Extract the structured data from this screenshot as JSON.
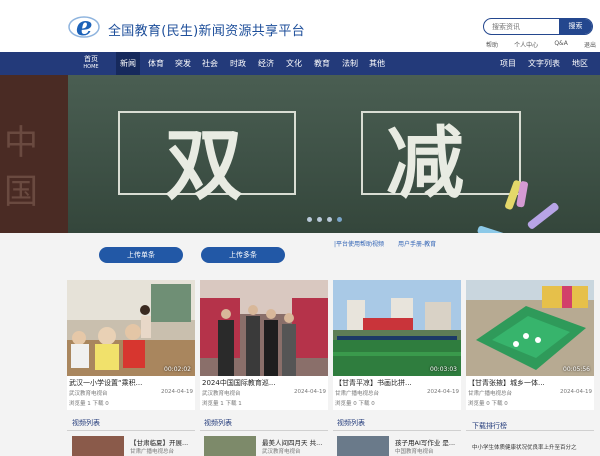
{
  "header": {
    "site_title": "全国教育(民生)新闻资源共享平台",
    "search_placeholder": "搜索资讯",
    "search_button": "搜索",
    "links": [
      "帮助",
      "个人中心",
      "Q&A",
      "退出"
    ]
  },
  "nav": {
    "home_cn": "首页",
    "home_en": "HOME",
    "items": [
      "新闻",
      "体育",
      "突发",
      "社会",
      "时政",
      "经济",
      "文化",
      "教育",
      "法制",
      "其他"
    ],
    "right_items": [
      "项目",
      "文字列表",
      "地区"
    ],
    "active_index": 0
  },
  "banner": {
    "left_text": "中国",
    "char_left": "双",
    "char_right": "减",
    "slide_count": 4,
    "active_slide": 3
  },
  "upload": {
    "single_label": "上传单条",
    "multi_label": "上传多条",
    "help_link_1": "|平台使用帮助视频",
    "help_link_2": "用户手册-教育"
  },
  "cards": [
    {
      "title": "武汉一小学设置“乘积...",
      "time": "00:02:02",
      "source": "武汉教育电视台",
      "date": "2024-04-19",
      "views": "浏览量 1",
      "downloads": "下载 0"
    },
    {
      "title": "2024中国国际教育巡...",
      "time": "",
      "source": "武汉教育电视台",
      "date": "2024-04-19",
      "views": "浏览量 1",
      "downloads": "下载 1"
    },
    {
      "title": "【甘青平凉】书画比拼...",
      "time": "00:03:03",
      "source": "甘肃广播电视总台",
      "date": "2024-04-19",
      "views": "浏览量 0",
      "downloads": "下载 0"
    },
    {
      "title": "【甘青张掖】城乡一体...",
      "time": "00:05:56",
      "source": "甘肃广播电视总台",
      "date": "2024-04-19",
      "views": "浏览量 0",
      "downloads": "下载 0"
    }
  ],
  "bottom": {
    "section_1": "视频列表",
    "section_2": "视频列表",
    "section_3": "视频列表",
    "item_1_title": "【甘肃临夏】开展...",
    "item_1_sub": "甘肃广播电视总台",
    "item_2_title": "最美人间四月天 共...",
    "item_2_sub": "武汉教育电视台",
    "item_3_title": "孩子用AI写作业 是...",
    "item_3_sub": "中国教育电视台",
    "rank_title": "下载排行榜",
    "rank_item_1": "中小学生体质健康状况优良率上升至百分之"
  },
  "colors": {
    "brand": "#233a7a",
    "button": "#2258a6",
    "link": "#2b5fb3"
  }
}
